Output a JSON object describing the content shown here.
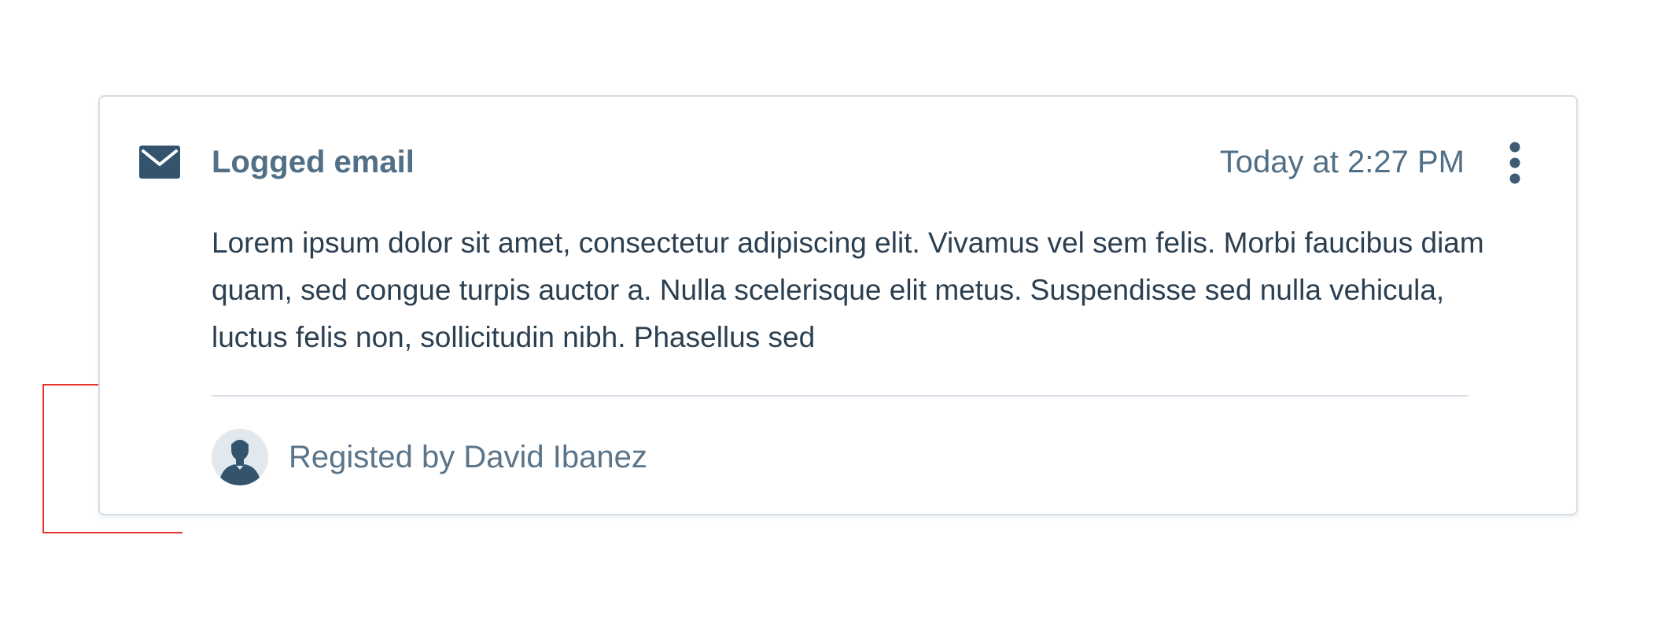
{
  "activity_card": {
    "title": "Logged email",
    "timestamp": "Today at 2:27 PM",
    "body": "Lorem ipsum dolor sit amet, consectetur adipiscing elit. Vivamus vel sem felis. Morbi faucibus diam quam, sed congue turpis auctor a. Nulla scelerisque elit metus. Suspendisse sed nulla vehicula, luctus felis non, sollicitudin nibh. Phasellus sed",
    "author_line": "Registed by David Ibanez",
    "icons": {
      "type_icon": "envelope-icon",
      "menu_icon": "more-vertical-icon",
      "avatar_icon": "user-silhouette-icon"
    }
  },
  "colors": {
    "icon": "#34536d",
    "title_text": "#516f86",
    "body_text": "#2b3f51",
    "border": "#d5dee6",
    "avatar_bg": "#e1e8ee",
    "annotation": "#e4342f"
  }
}
